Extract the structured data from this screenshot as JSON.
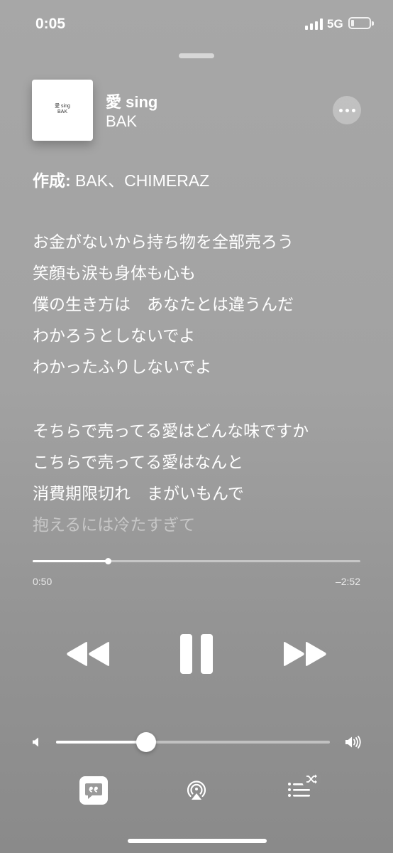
{
  "status_bar": {
    "time": "0:05",
    "network": "5G"
  },
  "now_playing": {
    "title": "愛 sing",
    "artist": "BAK",
    "art_text_line1": "愛 sing",
    "art_text_line2": "BAK"
  },
  "credits": {
    "label": "作成:",
    "value": " BAK、CHIMERAZ"
  },
  "lyrics": {
    "stanza1": [
      "お金がないから持ち物を全部売ろう",
      "笑顔も涙も身体も心も",
      "僕の生き方は　あなたとは違うんだ",
      "わかろうとしないでよ",
      "わかったふりしないでよ"
    ],
    "stanza2": [
      "そちらで売ってる愛はどんな味ですか",
      "こちらで売ってる愛はなんと",
      "消費期限切れ　まがいもんで",
      "抱えるには冷たすぎて"
    ]
  },
  "playback": {
    "elapsed": "0:50",
    "remaining": "–2:52",
    "progress": 0.23
  },
  "volume": {
    "level": 0.33
  },
  "icons": {
    "more": "ellipsis-icon",
    "rewind": "rewind-icon",
    "pause": "pause-icon",
    "forward": "fast-forward-icon",
    "vol_low": "speaker-low-icon",
    "vol_high": "speaker-high-icon",
    "lyrics": "lyrics-quote-icon",
    "airplay": "airplay-icon",
    "queue": "queue-list-icon",
    "shuffle": "shuffle-icon"
  }
}
